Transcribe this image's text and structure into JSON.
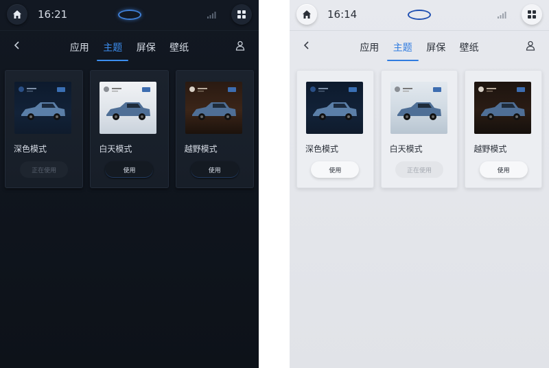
{
  "screens": [
    {
      "mode": "dark",
      "time": "16:21",
      "tabs": [
        {
          "label": "应用",
          "active": false
        },
        {
          "label": "主题",
          "active": true
        },
        {
          "label": "屏保",
          "active": false
        },
        {
          "label": "壁纸",
          "active": false
        }
      ],
      "cards": [
        {
          "title": "深色模式",
          "button": "正在使用",
          "current": true,
          "thumb": "dark"
        },
        {
          "title": "白天模式",
          "button": "使用",
          "current": false,
          "thumb": "day"
        },
        {
          "title": "越野模式",
          "button": "使用",
          "current": false,
          "thumb": "off"
        }
      ]
    },
    {
      "mode": "light",
      "time": "16:14",
      "tabs": [
        {
          "label": "应用",
          "active": false
        },
        {
          "label": "主题",
          "active": true
        },
        {
          "label": "屏保",
          "active": false
        },
        {
          "label": "壁纸",
          "active": false
        }
      ],
      "cards": [
        {
          "title": "深色模式",
          "button": "使用",
          "current": false,
          "thumb": "dark"
        },
        {
          "title": "白天模式",
          "button": "正在使用",
          "current": true,
          "thumb": "day"
        },
        {
          "title": "越野模式",
          "button": "使用",
          "current": false,
          "thumb": "off"
        }
      ]
    }
  ],
  "icons": {
    "home": "home-icon",
    "apps": "grid-icon",
    "signal": "signal-icon",
    "back": "back-chevron-icon",
    "user": "user-icon",
    "logo": "brand-logo-oval"
  },
  "colors": {
    "accent_dark": "#3c8ef0",
    "accent_light": "#2f7be0",
    "logo_blue": "#1f4fb1"
  }
}
